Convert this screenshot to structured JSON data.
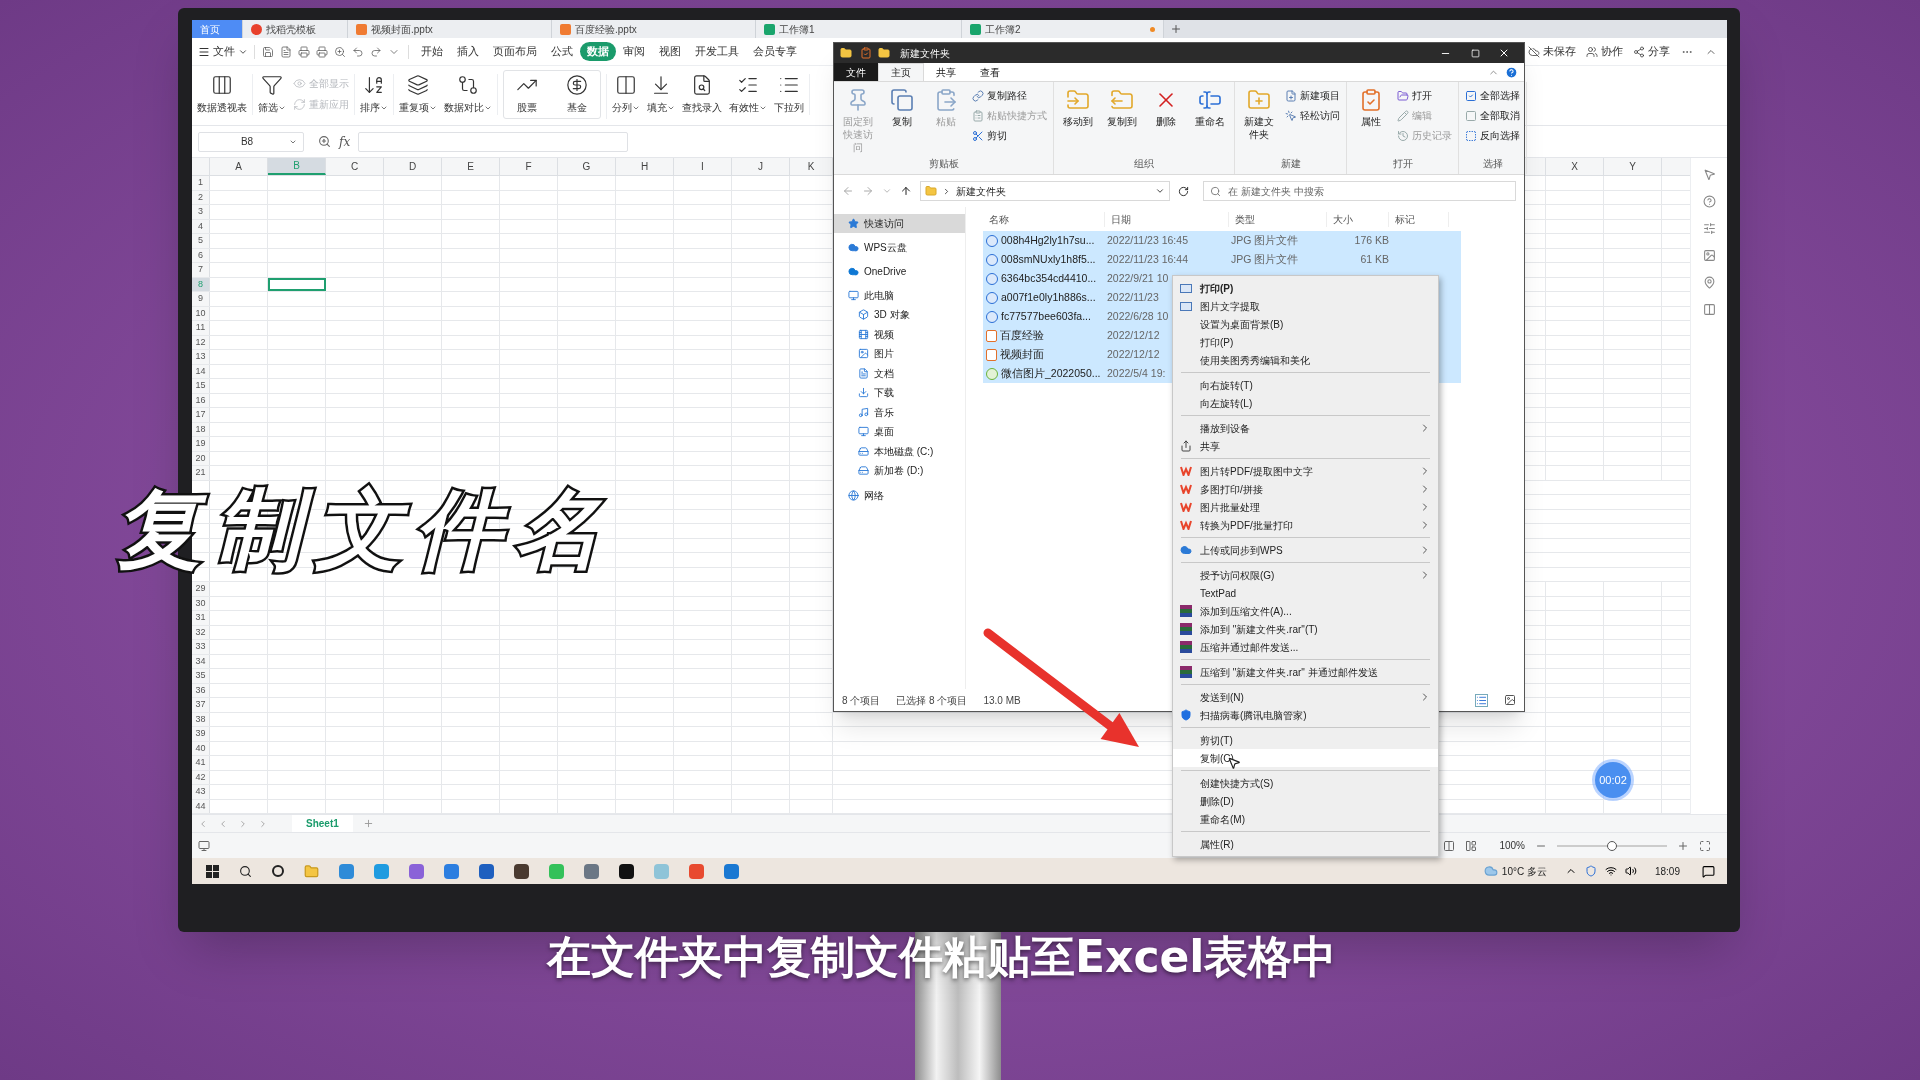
{
  "wps": {
    "tabs": [
      {
        "label": "首页",
        "selected": true,
        "kind": "home",
        "modified": false
      },
      {
        "label": "找稻壳模板",
        "selected": false,
        "kind": "docer",
        "modified": false
      },
      {
        "label": "视频封面.pptx",
        "selected": false,
        "kind": "ppt",
        "modified": false
      },
      {
        "label": "百度经验.pptx",
        "selected": false,
        "kind": "ppt",
        "modified": false
      },
      {
        "label": "工作簿1",
        "selected": false,
        "kind": "sheet",
        "modified": false
      },
      {
        "label": "工作簿2",
        "selected": false,
        "kind": "sheet",
        "modified": true
      }
    ],
    "file_menu": "文件",
    "menu": [
      {
        "label": "开始",
        "selected": false
      },
      {
        "label": "插入",
        "selected": false
      },
      {
        "label": "页面布局",
        "selected": false
      },
      {
        "label": "公式",
        "selected": false
      },
      {
        "label": "数据",
        "selected": true
      },
      {
        "label": "审阅",
        "selected": false
      },
      {
        "label": "视图",
        "selected": false
      },
      {
        "label": "开发工具",
        "selected": false
      },
      {
        "label": "会员专享",
        "selected": false
      }
    ],
    "actions": [
      "未保存",
      "协作",
      "分享"
    ],
    "toolbar": [
      [
        {
          "label": "数据透视表",
          "kind": "large",
          "dropdown": false,
          "disabled": false
        }
      ],
      [
        {
          "label": "筛选",
          "kind": "large",
          "dropdown": true,
          "disabled": false
        },
        {
          "label": "全部显示",
          "kind": "small",
          "dropdown": false,
          "disabled": true
        },
        {
          "label": "重新应用",
          "kind": "small",
          "dropdown": false,
          "disabled": true
        }
      ],
      [
        {
          "label": "排序",
          "kind": "large",
          "dropdown": true,
          "disabled": false
        }
      ],
      [
        {
          "label": "重复项",
          "kind": "large",
          "dropdown": true,
          "disabled": false
        },
        {
          "label": "数据对比",
          "kind": "large",
          "dropdown": true,
          "disabled": false
        }
      ],
      [
        {
          "label": "股票",
          "kind": "gallery",
          "dropdown": false,
          "disabled": false
        },
        {
          "label": "基金",
          "kind": "gallery",
          "dropdown": false,
          "disabled": false
        }
      ],
      [
        {
          "label": "分列",
          "kind": "large",
          "dropdown": true,
          "disabled": false
        },
        {
          "label": "填充",
          "kind": "large",
          "dropdown": true,
          "disabled": false
        },
        {
          "label": "查找录入",
          "kind": "large",
          "dropdown": false,
          "disabled": false
        },
        {
          "label": "有效性",
          "kind": "large",
          "dropdown": true,
          "disabled": false
        },
        {
          "label": "下拉列",
          "kind": "large",
          "dropdown": false,
          "disabled": false
        }
      ]
    ],
    "name_box": "B8",
    "formula_label": "fx",
    "columns": [
      {
        "label": "A",
        "selected": false
      },
      {
        "label": "B",
        "selected": true
      },
      {
        "label": "C",
        "selected": false
      },
      {
        "label": "D",
        "selected": false
      },
      {
        "label": "E",
        "selected": false
      },
      {
        "label": "F",
        "selected": false
      },
      {
        "label": "G",
        "selected": false
      },
      {
        "label": "H",
        "selected": false
      },
      {
        "label": "I",
        "selected": false
      },
      {
        "label": "J",
        "selected": false
      },
      {
        "label": "K",
        "selected": false
      }
    ],
    "columns_right": [
      {
        "label": "X",
        "selected": false
      },
      {
        "label": "Y",
        "selected": false
      }
    ],
    "rows_top": [
      {
        "label": "1",
        "selected": false
      },
      {
        "label": "2",
        "selected": false
      },
      {
        "label": "3",
        "selected": false
      },
      {
        "label": "4",
        "selected": false
      },
      {
        "label": "5",
        "selected": false
      },
      {
        "label": "6",
        "selected": false
      },
      {
        "label": "7",
        "selected": false
      },
      {
        "label": "8",
        "selected": true
      },
      {
        "label": "9",
        "selected": false
      },
      {
        "label": "10",
        "selected": false
      },
      {
        "label": "11",
        "selected": false
      },
      {
        "label": "12",
        "selected": false
      },
      {
        "label": "13",
        "selected": false
      },
      {
        "label": "14",
        "selected": false
      },
      {
        "label": "15",
        "selected": false
      },
      {
        "label": "16",
        "selected": false
      },
      {
        "label": "17",
        "selected": false
      },
      {
        "label": "18",
        "selected": false
      },
      {
        "label": "19",
        "selected": false
      },
      {
        "label": "20",
        "selected": false
      },
      {
        "label": "21",
        "selected": false
      }
    ],
    "rows_bottom": [
      {
        "label": "29",
        "selected": false
      },
      {
        "label": "30",
        "selected": false
      },
      {
        "label": "31",
        "selected": false
      },
      {
        "label": "32",
        "selected": false
      },
      {
        "label": "33",
        "selected": false
      },
      {
        "label": "34",
        "selected": false
      },
      {
        "label": "35",
        "selected": false
      },
      {
        "label": "36",
        "selected": false
      },
      {
        "label": "37",
        "selected": false
      },
      {
        "label": "38",
        "selected": false
      },
      {
        "label": "39",
        "selected": false
      },
      {
        "label": "40",
        "selected": false
      },
      {
        "label": "41",
        "selected": false
      },
      {
        "label": "42",
        "selected": false
      },
      {
        "label": "43",
        "selected": false
      },
      {
        "label": "44",
        "selected": false
      }
    ],
    "sheets": [
      {
        "label": "Sheet1",
        "selected": true
      }
    ],
    "zoom": {
      "reading": "100%",
      "level": 0.5
    }
  },
  "explorer": {
    "title": "新建文件夹",
    "ribbon_tabs": [
      {
        "label": "文件",
        "selected": false,
        "kind": "file"
      },
      {
        "label": "主页",
        "selected": true,
        "kind": "tab"
      },
      {
        "label": "共享",
        "selected": false,
        "kind": "tab"
      },
      {
        "label": "查看",
        "selected": false,
        "kind": "tab"
      }
    ],
    "ribbon_groups": [
      {
        "label": "剪贴板",
        "items": [
          {
            "label": "固定到快速访问",
            "kind": "large",
            "disabled": true
          },
          {
            "label": "复制",
            "kind": "large",
            "disabled": false
          },
          {
            "label": "粘贴",
            "kind": "large",
            "disabled": true
          },
          {
            "label": "复制路径",
            "kind": "small",
            "disabled": false
          },
          {
            "label": "粘贴快捷方式",
            "kind": "small",
            "disabled": true
          },
          {
            "label": "剪切",
            "kind": "small",
            "disabled": false
          }
        ]
      },
      {
        "label": "组织",
        "items": [
          {
            "label": "移动到",
            "kind": "large",
            "disabled": false
          },
          {
            "label": "复制到",
            "kind": "large",
            "disabled": false
          },
          {
            "label": "删除",
            "kind": "large",
            "disabled": false
          },
          {
            "label": "重命名",
            "kind": "large",
            "disabled": false
          }
        ]
      },
      {
        "label": "新建",
        "items": [
          {
            "label": "新建文件夹",
            "kind": "large",
            "disabled": false
          },
          {
            "label": "新建项目",
            "kind": "small",
            "disabled": false
          },
          {
            "label": "轻松访问",
            "kind": "small",
            "disabled": false
          }
        ]
      },
      {
        "label": "打开",
        "items": [
          {
            "label": "属性",
            "kind": "large",
            "disabled": false
          },
          {
            "label": "打开",
            "kind": "small",
            "disabled": false
          },
          {
            "label": "编辑",
            "kind": "small",
            "disabled": true
          },
          {
            "label": "历史记录",
            "kind": "small",
            "disabled": true
          }
        ]
      },
      {
        "label": "选择",
        "items": [
          {
            "label": "全部选择",
            "kind": "small",
            "disabled": false
          },
          {
            "label": "全部取消",
            "kind": "small",
            "disabled": false
          },
          {
            "label": "反向选择",
            "kind": "small",
            "disabled": false
          }
        ]
      }
    ],
    "address": "新建文件夹",
    "search": {
      "placeholder": "在 新建文件夹 中搜索"
    },
    "columns": [
      "名称",
      "日期",
      "类型",
      "大小",
      "标记"
    ],
    "nav": [
      {
        "label": "快速访问",
        "selected": true
      },
      {
        "label": "WPS云盘",
        "selected": false
      },
      {
        "label": "OneDrive",
        "selected": false
      },
      {
        "label": "此电脑",
        "selected": false,
        "children": [
          {
            "label": "3D 对象",
            "selected": false
          },
          {
            "label": "视频",
            "selected": false
          },
          {
            "label": "图片",
            "selected": false
          },
          {
            "label": "文档",
            "selected": false
          },
          {
            "label": "下载",
            "selected": false
          },
          {
            "label": "音乐",
            "selected": false
          },
          {
            "label": "桌面",
            "selected": false
          },
          {
            "label": "本地磁盘 (C:)",
            "selected": false
          },
          {
            "label": "新加卷 (D:)",
            "selected": false
          }
        ]
      },
      {
        "label": "网络",
        "selected": false
      }
    ],
    "files": [
      {
        "name": "008h4Hg2ly1h7su...",
        "date": "2022/11/23 16:45",
        "type": "JPG 图片文件",
        "size": "176 KB",
        "kind": "jpg",
        "selected": true
      },
      {
        "name": "008smNUxly1h8f5...",
        "date": "2022/11/23 16:44",
        "type": "JPG 图片文件",
        "size": "61 KB",
        "kind": "jpg",
        "selected": true
      },
      {
        "name": "6364bc354cd4410...",
        "date": "2022/9/21 10",
        "kind": "jpg",
        "selected": true
      },
      {
        "name": "a007f1e0ly1h886s...",
        "date": "2022/11/23",
        "kind": "jpg",
        "selected": true
      },
      {
        "name": "fc77577bee603fa...",
        "date": "2022/6/28 10",
        "kind": "jpg",
        "selected": true
      },
      {
        "name": "百度经验",
        "date": "2022/12/12",
        "kind": "ppt",
        "selected": true
      },
      {
        "name": "视频封面",
        "date": "2022/12/12",
        "kind": "ppt",
        "selected": true
      },
      {
        "name": "微信图片_2022050...",
        "date": "2022/5/4 19:",
        "kind": "png",
        "selected": true
      }
    ],
    "status": [
      "8 个项目",
      "已选择 8 个项目",
      "13.0 MB"
    ]
  },
  "context_menu": {
    "groups": [
      [
        {
          "label": "打印(P)",
          "kind": "doc",
          "bold": true,
          "submenu": false,
          "selected": false
        },
        {
          "label": "图片文字提取",
          "kind": "doc",
          "bold": false,
          "submenu": false,
          "selected": false
        },
        {
          "label": "设置为桌面背景(B)",
          "kind": "plain",
          "bold": false,
          "submenu": false,
          "selected": false
        },
        {
          "label": "打印(P)",
          "kind": "plain",
          "bold": false,
          "submenu": false,
          "selected": false
        },
        {
          "label": "使用美图秀秀编辑和美化",
          "kind": "plain",
          "bold": false,
          "submenu": false,
          "selected": false
        }
      ],
      [
        {
          "label": "向右旋转(T)",
          "kind": "plain",
          "bold": false,
          "submenu": false,
          "selected": false
        },
        {
          "label": "向左旋转(L)",
          "kind": "plain",
          "bold": false,
          "submenu": false,
          "selected": false
        }
      ],
      [
        {
          "label": "播放到设备",
          "kind": "plain",
          "bold": false,
          "submenu": true,
          "selected": false
        },
        {
          "label": "共享",
          "kind": "share",
          "bold": false,
          "submenu": false,
          "selected": false
        }
      ],
      [
        {
          "label": "图片转PDF/提取图中文字",
          "kind": "wps",
          "bold": false,
          "submenu": true,
          "selected": false
        },
        {
          "label": "多图打印/拼接",
          "kind": "wps",
          "bold": false,
          "submenu": true,
          "selected": false
        },
        {
          "label": "图片批量处理",
          "kind": "wps",
          "bold": false,
          "submenu": true,
          "selected": false
        },
        {
          "label": "转换为PDF/批量打印",
          "kind": "wps",
          "bold": false,
          "submenu": true,
          "selected": false
        }
      ],
      [
        {
          "label": "上传或同步到WPS",
          "kind": "cloud",
          "bold": false,
          "submenu": true,
          "selected": false
        }
      ],
      [
        {
          "label": "授予访问权限(G)",
          "kind": "plain",
          "bold": false,
          "submenu": true,
          "selected": false
        },
        {
          "label": "TextPad",
          "kind": "plain",
          "bold": false,
          "submenu": false,
          "selected": false
        },
        {
          "label": "添加到压缩文件(A)...",
          "kind": "rar",
          "bold": false,
          "submenu": false,
          "selected": false
        },
        {
          "label": "添加到 \"新建文件夹.rar\"(T)",
          "kind": "rar",
          "bold": false,
          "submenu": false,
          "selected": false
        },
        {
          "label": "压缩并通过邮件发送...",
          "kind": "rar",
          "bold": false,
          "submenu": false,
          "selected": false
        }
      ],
      [
        {
          "label": "压缩到 \"新建文件夹.rar\" 并通过邮件发送",
          "kind": "rar",
          "bold": false,
          "submenu": false,
          "selected": false
        }
      ],
      [
        {
          "label": "发送到(N)",
          "kind": "plain",
          "bold": false,
          "submenu": true,
          "selected": false
        },
        {
          "label": "扫描病毒(腾讯电脑管家)",
          "kind": "shield",
          "bold": false,
          "submenu": false,
          "selected": false
        }
      ],
      [
        {
          "label": "剪切(T)",
          "kind": "plain",
          "bold": false,
          "submenu": false,
          "selected": false
        },
        {
          "label": "复制(C)",
          "kind": "plain",
          "bold": false,
          "submenu": false,
          "selected": true
        }
      ],
      [
        {
          "label": "创建快捷方式(S)",
          "kind": "plain",
          "bold": false,
          "submenu": false,
          "selected": false
        },
        {
          "label": "删除(D)",
          "kind": "plain",
          "bold": false,
          "submenu": false,
          "selected": false
        },
        {
          "label": "重命名(M)",
          "kind": "plain",
          "bold": false,
          "submenu": false,
          "selected": false
        }
      ],
      [
        {
          "label": "属性(R)",
          "kind": "plain",
          "bold": false,
          "submenu": false,
          "selected": false
        }
      ]
    ]
  },
  "taskbar": {
    "weather": "10°C 多云",
    "time": "18:09"
  },
  "timer": "00:02",
  "caption_title": "复制文件名",
  "subtitle": "在文件夹中复制文件粘贴至Excel表格中"
}
